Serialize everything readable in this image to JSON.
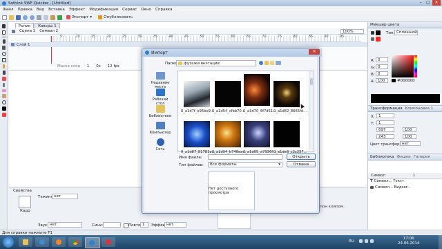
{
  "app": {
    "title": "Sothink SWF Quicker - [Untitled]",
    "menu": [
      "Файл",
      "Правка",
      "Вид",
      "Вставка",
      "Эффект",
      "Модификация",
      "Сервис",
      "Окно",
      "Справка"
    ],
    "toolbar": {
      "export_label": "Экспорт",
      "publish_label": "Опубликовать"
    },
    "doc_tabs": [
      "Ролик",
      "Ковсры 1"
    ],
    "scene_crumbs": [
      "Сцена 1",
      "Символ 2"
    ],
    "zoom": "100%",
    "layer_name": "Слой 1",
    "timeline_status": {
      "frame": "1",
      "time": "0s",
      "fps": "12 fps",
      "layer_field": "Маска слоя"
    },
    "frame_numbers": [
      "5",
      "10",
      "15",
      "20",
      "25",
      "30",
      "35",
      "40",
      "45",
      "50",
      "55",
      "60",
      "65",
      "70",
      "75",
      "80",
      "85",
      "90",
      "95"
    ]
  },
  "properties": {
    "tab": "Свойства",
    "item": "Кадр",
    "label_prop": "Тэжинг:",
    "label_value": "нет",
    "sound_label": "Звук:",
    "sound_value": "нет",
    "sync_label": "Синх:",
    "repeat_label": "Повтор",
    "repeat_value": "1",
    "effect_label": "Эффект:",
    "effect_value": "нет",
    "hint": "...пон клипом."
  },
  "color_panel": {
    "title": "Микшер цвета",
    "type_label": "Тип:",
    "type_value": "Сплошной",
    "r_label": "R:",
    "r_value": "0",
    "g_label": "G:",
    "g_value": "0",
    "b_label": "B:",
    "b_value": "0",
    "a_label": "A:",
    "a_value": "100",
    "hex": "#000000"
  },
  "transform_panel": {
    "tab1": "Трансформация",
    "tab2": "Компоновка 1",
    "x_label": "X:",
    "x_value": "1",
    "y_label": "Y:",
    "y_value": "1",
    "w_value": "697",
    "h_value": "243",
    "sx_value": "100",
    "sy_value": "100",
    "color_effect_label": "Цвет трансформ:",
    "color_effect_value": "нет"
  },
  "library_panel": {
    "tabs": [
      "Библиотека",
      "Фишки",
      "Галерея"
    ],
    "col_name": "Символ",
    "col_count": "1",
    "items": [
      "Символ... Текст",
      "Символ... Видеоr..."
    ]
  },
  "dialog": {
    "title": "Импорт",
    "folder_label": "Папка:",
    "folder_value": "футажи внэтация",
    "places": [
      "Недавние места",
      "Рабочий стол",
      "Библиотеки",
      "Компьютер",
      "Сеть"
    ],
    "files": [
      {
        "name": "0_a1d7f_e95be9...",
        "color": "#d8dde4"
      },
      {
        "name": "0_a1d54_cfbb70...",
        "color": "#050505"
      },
      {
        "name": "0_a1d70_6f7d51...",
        "color": "#7a2c0f"
      },
      {
        "name": "0_a1d82_8665fd...",
        "color": "#1a1206"
      },
      {
        "name": "0_a1d87_81781e...",
        "color": "#1b4ec8"
      },
      {
        "name": "0_a1d94_b748ea...",
        "color": "#d27a12"
      },
      {
        "name": "0_a1d95_a7936f...",
        "color": "#3a3f7a"
      },
      {
        "name": "0_a1de8_c3c337...",
        "color": "#020202"
      }
    ],
    "filename_label": "Имя файла:",
    "filename_value": "",
    "filetype_label": "Тип файлов:",
    "filetype_value": "Все форматы",
    "open_label": "Открыть",
    "cancel_label": "Отмена",
    "preview_text": "Нет доступного просмотра"
  },
  "status_bar": {
    "text": "Для справки нажмите F1"
  },
  "taskbar": {
    "lang": "RU",
    "time": "17:06",
    "date": "24.06.2014"
  }
}
